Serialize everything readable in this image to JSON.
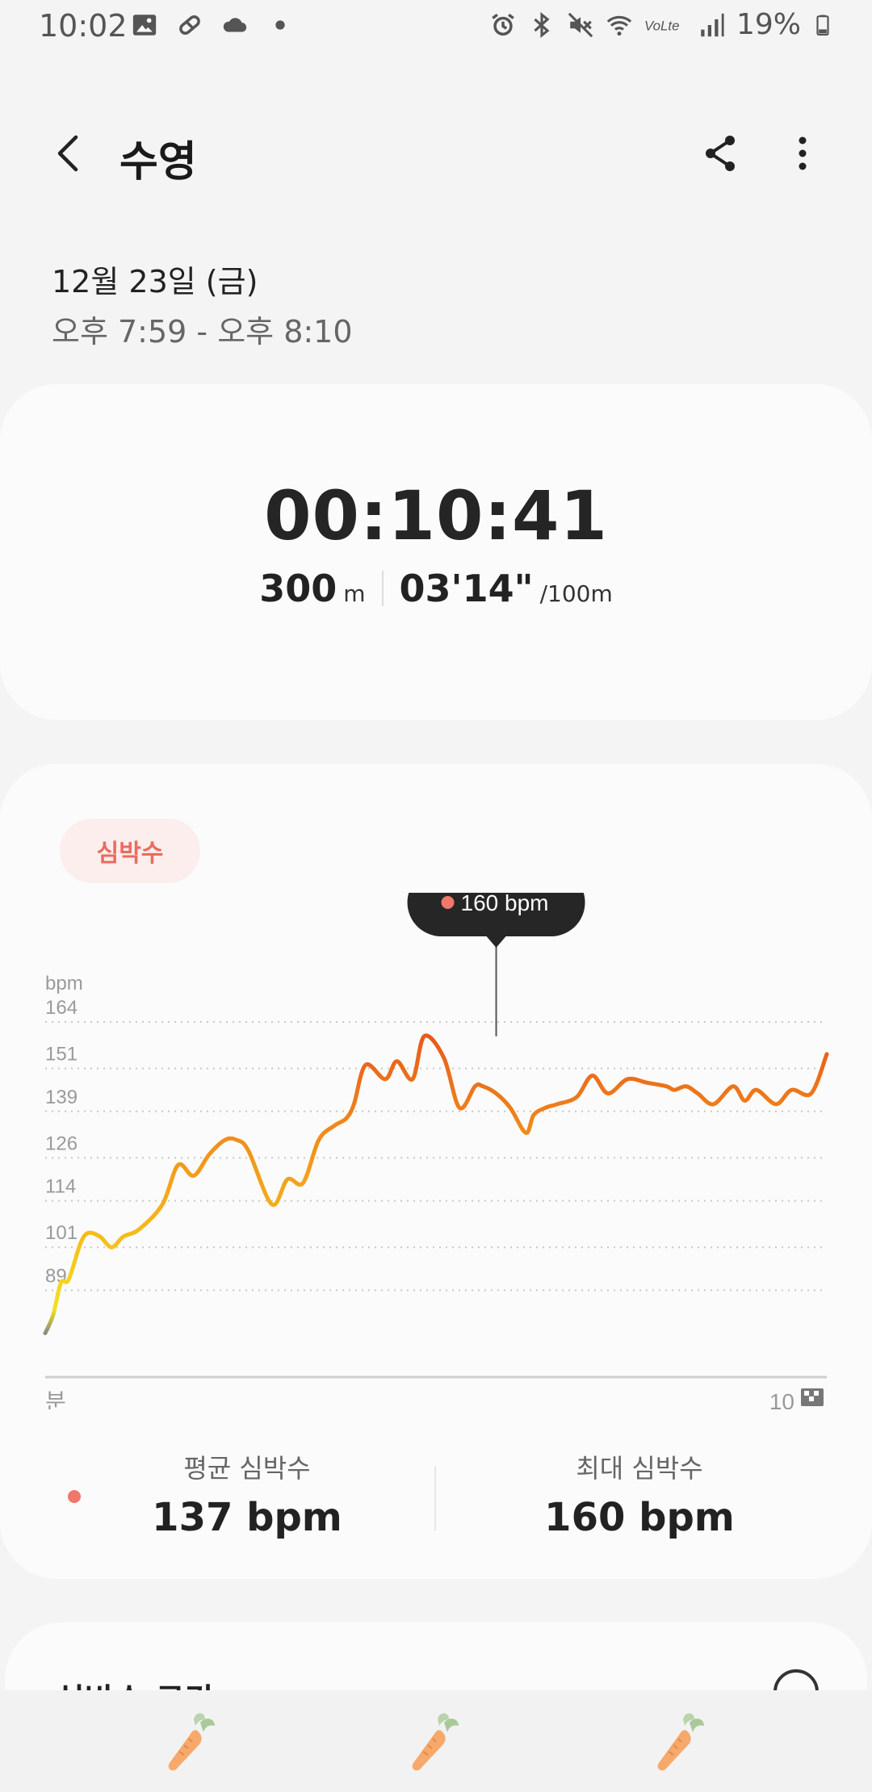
{
  "status_bar": {
    "time": "10:02",
    "battery": "19%",
    "left_icons": [
      "image-icon",
      "pill-icon",
      "cloud-icon",
      "dot-icon"
    ],
    "right_icons": [
      "alarm-icon",
      "bluetooth-icon",
      "mute-icon",
      "wifi-icon",
      "volte-icon",
      "signal-icon",
      "battery-icon"
    ]
  },
  "header": {
    "title": "수영"
  },
  "session": {
    "date": "12월 23일 (금)",
    "time_range": "오후 7:59 - 오후 8:10"
  },
  "summary": {
    "duration": "00:10:41",
    "distance_value": "300",
    "distance_unit": "m",
    "pace_value": "03'14\"",
    "pace_unit": "/100m"
  },
  "heart_rate": {
    "chip_label": "심박수",
    "tooltip": "160 bpm",
    "avg_label": "평균 심박수",
    "avg_value": "137 bpm",
    "max_label": "최대 심박수",
    "max_value": "160 bpm"
  },
  "chart_data": {
    "type": "line",
    "ylabel": "bpm",
    "xlabel": "분",
    "x_end_label": "10",
    "y_ticks": [
      164,
      151,
      139,
      126,
      114,
      101,
      89
    ],
    "xlim": [
      0,
      10
    ],
    "ylim": [
      76,
      164
    ],
    "grid": true,
    "highlight": {
      "x": 5.77,
      "y": 160,
      "label": "160 bpm"
    },
    "series": [
      {
        "x": [
          0,
          0.1,
          0.2,
          0.3,
          0.45,
          0.55,
          0.7,
          0.85,
          1.0,
          1.2,
          1.5,
          1.7,
          1.9,
          2.1,
          2.3,
          2.45,
          2.6,
          2.9,
          3.1,
          3.3,
          3.5,
          3.7,
          3.85,
          3.95,
          4.1,
          4.35,
          4.5,
          4.7,
          4.85,
          5.1,
          5.3,
          5.5,
          5.6,
          5.77,
          5.95,
          6.15,
          6.25,
          6.4,
          6.55,
          6.8,
          7.0,
          7.2,
          7.45,
          7.7,
          7.95,
          8.05,
          8.2,
          8.35,
          8.55,
          8.8,
          8.95,
          9.1,
          9.35,
          9.55,
          9.8,
          10.0
        ],
        "y": [
          77,
          82,
          91,
          92,
          102,
          105,
          104,
          101,
          104,
          106,
          113,
          124,
          121,
          127,
          131,
          131,
          128,
          113,
          120,
          119,
          131,
          135,
          137,
          141,
          152,
          148,
          153,
          148,
          160,
          154,
          140,
          146,
          146,
          144,
          140,
          133,
          138,
          140,
          141,
          143,
          149,
          144,
          148,
          147,
          146,
          145,
          146,
          144,
          141,
          146,
          142,
          145,
          141,
          145,
          144,
          155
        ]
      }
    ]
  },
  "next_card": {
    "title": "심박수 구간"
  },
  "bottom_nav": [
    "carrot-icon",
    "carrot-icon",
    "carrot-icon"
  ]
}
